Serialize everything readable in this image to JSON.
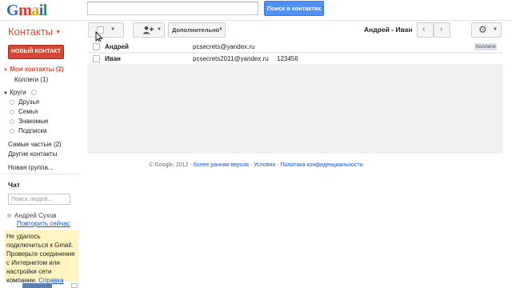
{
  "header": {
    "logo_letters": [
      "G",
      "m",
      "a",
      "i",
      "l"
    ],
    "search_button": "Поиск в контактах"
  },
  "app": {
    "title": "Контакты"
  },
  "toolbar": {
    "more_label": "Дополнительно",
    "current_contact": "Андрей - Иван"
  },
  "sidebar": {
    "new_contact": "НОВЫЙ КОНТАКТ",
    "my_contacts": "Мои контакты (2)",
    "colleagues": "Коллеги (1)",
    "circles": "Круги",
    "circle_items": [
      "Друзья",
      "Семья",
      "Знакомые",
      "Подписки"
    ],
    "frequent": "Самые частые (2)",
    "other": "Другие контакты",
    "new_group": "Новая группа..."
  },
  "contacts": [
    {
      "name": "Андрей",
      "email": "pcsecrets@yandex.ru",
      "phone": "",
      "tag": "Коллеги"
    },
    {
      "name": "Иван",
      "email": "pcsecrets2011@yandex.ru",
      "phone": "123456",
      "tag": ""
    }
  ],
  "footer": {
    "copyright": "© Google, 2012 -",
    "old_version": "более ранняя версия",
    "terms": "Условия",
    "privacy": "Политика конфиденциальности",
    "sep": "-"
  },
  "chat": {
    "title": "Чат",
    "search_placeholder": "Поиск людей...",
    "user": "Андрей Сухов",
    "retry": "Повторить сейчас",
    "warning": "Не удалось подключиться к Gmail. Проверьте соединение с Интернетом или настройки сети компании.",
    "help": "Справка"
  },
  "colors": {
    "accent_red": "#dd4b39",
    "button_blue": "#4d90fe",
    "new_contact_red": "#d14836"
  }
}
